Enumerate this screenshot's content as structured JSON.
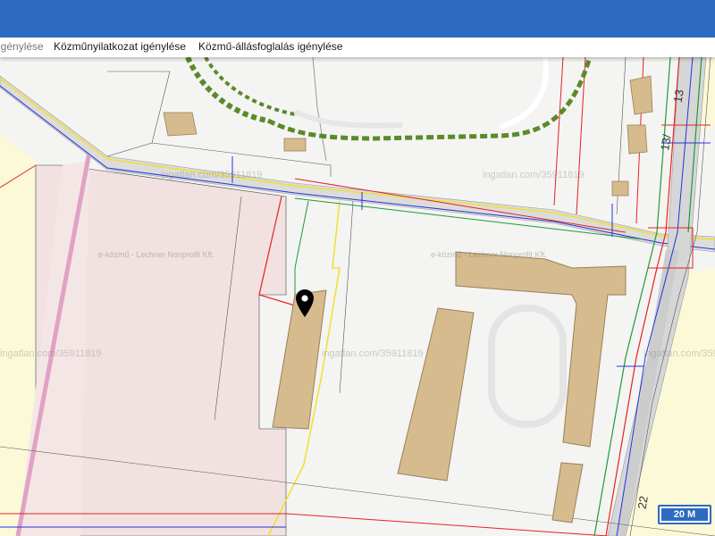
{
  "tabs": [
    {
      "label": "igénylése"
    },
    {
      "label": "Közműnyilatkozat igénylése"
    },
    {
      "label": "Közmű-állásfoglalás igénylése"
    }
  ],
  "watermarks": {
    "ingatlan": "ingatlan.com/35911819",
    "ekozmu": "e-közmű - Lechner Nonprofit Kft."
  },
  "street_numbers": [
    "13",
    "13/",
    "22"
  ],
  "scale_label": "20 M",
  "colors": {
    "header": "#2d6bc0",
    "utility_red": "#e52222",
    "utility_blue": "#2233dd",
    "utility_green": "#1f9a3a",
    "utility_yellow": "#f0e030",
    "building": "#d6bb8e",
    "parcel_pink": "#f2e1e1",
    "grass": "#fbf9d8",
    "rail_green": "#5a8a2a"
  },
  "icons": [
    "location-pin-icon"
  ]
}
